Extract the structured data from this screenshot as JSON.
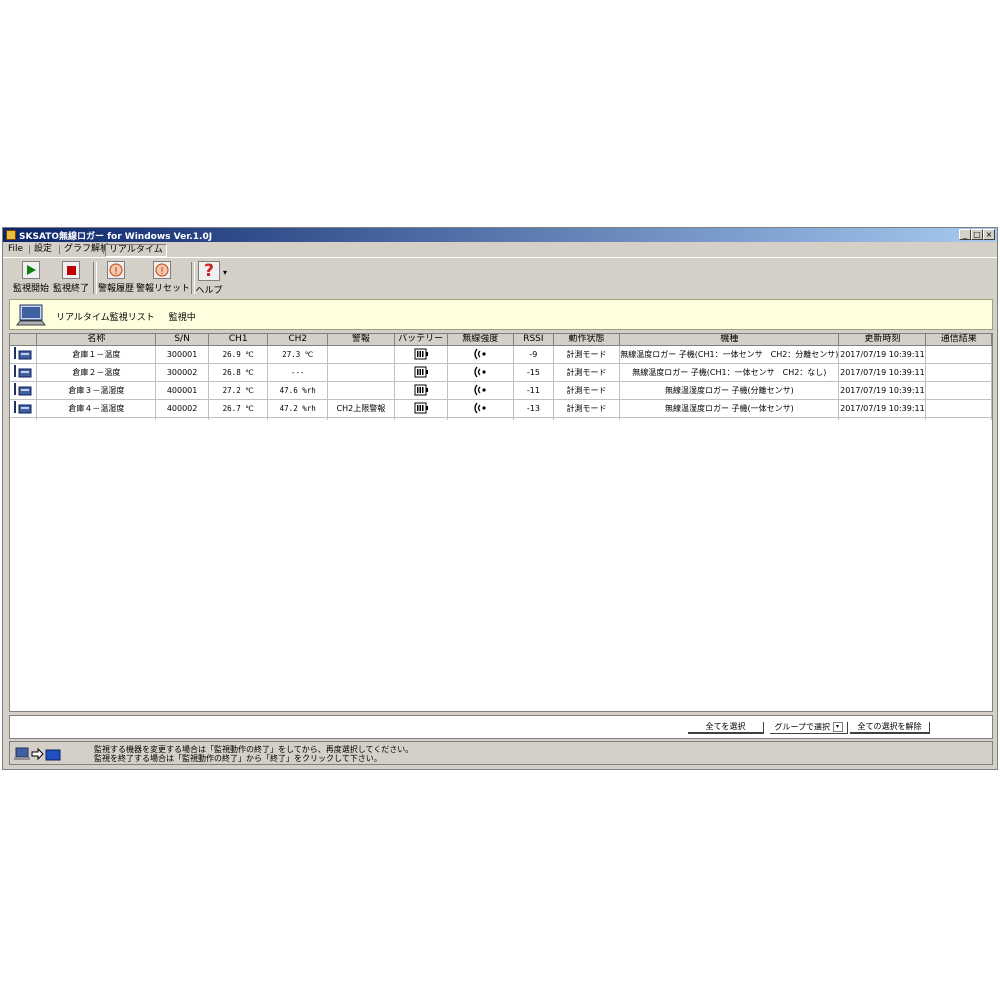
{
  "window": {
    "title": "SKSATO無線ロガー for Windows Ver.1.0J",
    "caption_buttons": [
      "_",
      "□",
      "×"
    ]
  },
  "menu": {
    "items": [
      "File",
      "設定",
      "グラフ解析",
      "リアルタイム"
    ],
    "active": "リアルタイム"
  },
  "toolbar": {
    "start_label": "監視開始",
    "stop_label": "監視終了",
    "alarm_history_label": "警報履歴",
    "alarm_reset_label": "警報リセット",
    "help_label": "ヘルプ",
    "help_glyph": "?",
    "alarm_glyph": "!",
    "dropdown_arrow": "▾"
  },
  "banner": {
    "list_title": "リアルタイム監視リスト",
    "status": "監視中"
  },
  "table": {
    "columns": [
      "名称",
      "S/N",
      "CH1",
      "CH2",
      "警報",
      "バッテリー",
      "無線強度",
      "RSSI",
      "動作状態",
      "機種",
      "更新時刻",
      "通信結果"
    ],
    "rows": [
      {
        "name": "倉庫１－温度",
        "sn": "300001",
        "ch1": "26.9 ℃",
        "ch2": "27.3 ℃",
        "alarm": "",
        "rssi": "-9",
        "state": "計測モード",
        "model": "無線温度ロガー 子機(CH1：一体センサ　CH2：分離センサ)",
        "updated": "2017/07/19 10:39:11",
        "result": ""
      },
      {
        "name": "倉庫２－温度",
        "sn": "300002",
        "ch1": "26.8 ℃",
        "ch2": "---",
        "alarm": "",
        "rssi": "-15",
        "state": "計測モード",
        "model": "無線温度ロガー 子機(CH1：一体センサ　CH2：なし)",
        "updated": "2017/07/19 10:39:11",
        "result": ""
      },
      {
        "name": "倉庫３－温湿度",
        "sn": "400001",
        "ch1": "27.2 ℃",
        "ch2": "47.6 %rh",
        "alarm": "",
        "rssi": "-11",
        "state": "計測モード",
        "model": "無線温湿度ロガー 子機(分離センサ)",
        "updated": "2017/07/19 10:39:11",
        "result": ""
      },
      {
        "name": "倉庫４－温湿度",
        "sn": "400002",
        "ch1": "26.7 ℃",
        "ch2": "47.2 %rh",
        "alarm": "CH2上限警報",
        "rssi": "-13",
        "state": "計測モード",
        "model": "無線温湿度ロガー 子機(一体センサ)",
        "updated": "2017/07/19 10:39:11",
        "result": ""
      }
    ]
  },
  "selection": {
    "select_all": "全てを選択",
    "group_select": "グループで選択",
    "clear_all": "全ての選択を解除"
  },
  "footer": {
    "line1": "監視する機器を変更する場合は「監視動作の終了」をしてから、再度選択してください。",
    "line2": "監視を終了する場合は「監視動作の終了」から「終了」をクリックして下さい。"
  }
}
